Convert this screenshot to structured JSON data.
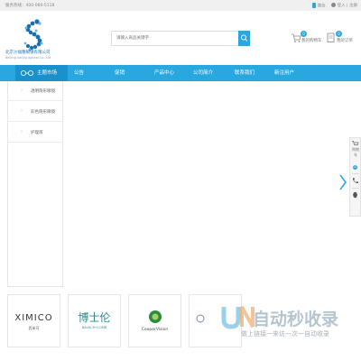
{
  "topbar": {
    "hotline": "服务热线：400-080-5118",
    "wechat_label": "微信",
    "login_label": "登入",
    "register_label": "注册"
  },
  "logo": {
    "company_name": "北京沙福隆眼镜有限公司",
    "english_name": "Beijing  Safulo optical Co.,Ltd",
    "brand_color": "#1a6fb0"
  },
  "search": {
    "placeholder": "请输入商品关键字",
    "icon": "search-icon"
  },
  "header_links": [
    {
      "label": "我的购物车",
      "badge": "0",
      "icon": "cart-icon"
    },
    {
      "label": "我的订单",
      "badge": "0",
      "icon": "order-icon"
    }
  ],
  "nav": {
    "home_label": "主题市场",
    "items": [
      "公告",
      "促销",
      "产品中心",
      "公司简介",
      "联系我们",
      "新注用户"
    ],
    "color": "#29a8e0"
  },
  "sidebar": {
    "items": [
      "透明隐形眼镜",
      "彩色隐形眼镜",
      "护理液"
    ]
  },
  "float_panel": {
    "cart_label": "购物车",
    "cart_count": "0",
    "icons": [
      "cart-icon",
      "phone-icon",
      "qq-icon"
    ]
  },
  "brands": [
    {
      "name": "XIMICO",
      "sub": "西米可"
    },
    {
      "name": "博士伦",
      "sub": "BAUSCH+LOMB"
    },
    {
      "name": "CooperVision",
      "sub": ""
    }
  ],
  "watermark": {
    "main": "自动秒收录",
    "sub": "做上链接一来访一次一自动收录"
  }
}
